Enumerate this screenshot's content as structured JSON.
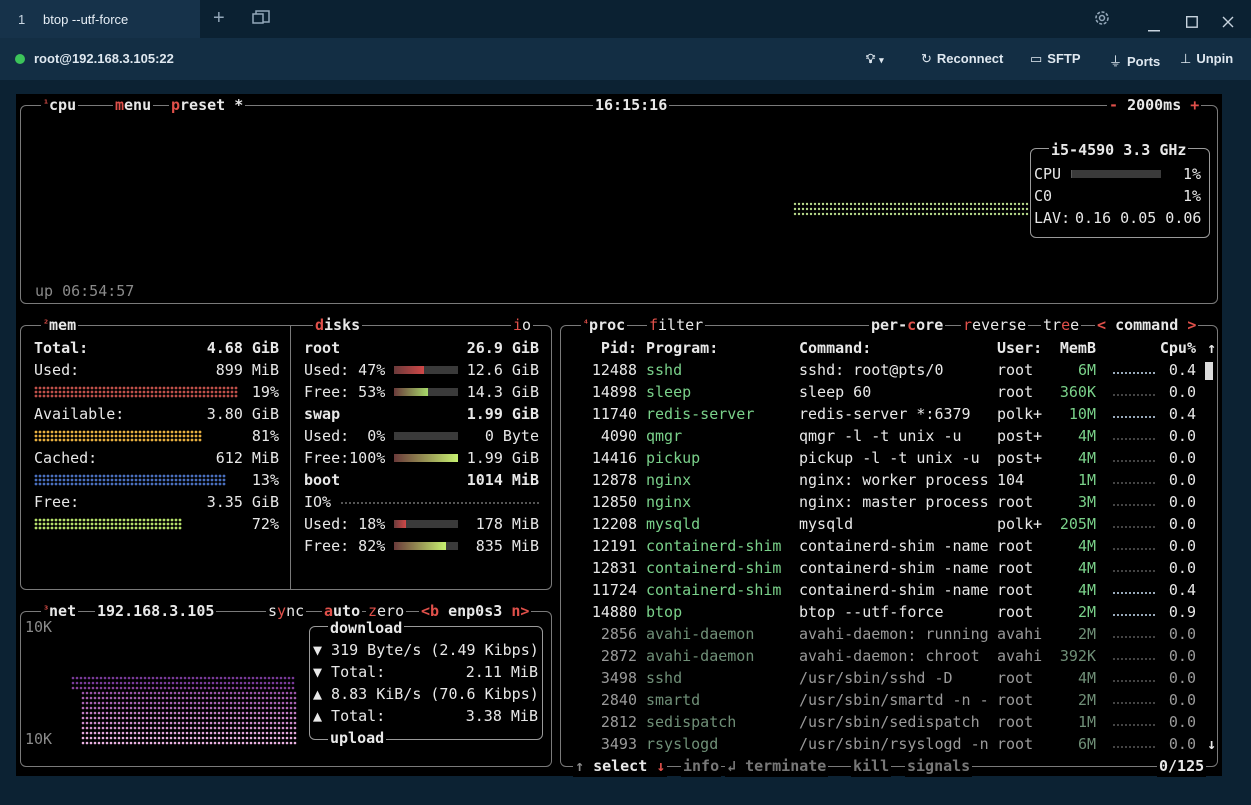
{
  "window": {
    "tab_number": "1",
    "tab_title": "btop --utf-force",
    "new_tab_icon": "plus-icon",
    "tabs_overview_icon": "tabs-icon",
    "settings_icon": "gear-icon",
    "minimize_icon": "minimize-icon",
    "maximize_icon": "maximize-icon",
    "close_icon": "close-icon"
  },
  "connection": {
    "label": "root@192.168.3.105:22",
    "status_color": "#3cc45a",
    "buttons": {
      "hint": "",
      "reconnect": "Reconnect",
      "sftp": "SFTP",
      "ports": "Ports",
      "unpin": "Unpin"
    }
  },
  "cpu": {
    "num": "¹",
    "title": "cpu",
    "menu_key": "m",
    "menu_rest": "enu",
    "preset_key": "p",
    "preset_rest": "reset *",
    "time": "16:15:16",
    "minus": "-",
    "interval": "2000ms",
    "plus": "+",
    "uptime": "up 06:54:57",
    "model": "i5-4590",
    "freq": "3.3 GHz",
    "cpu_label": "CPU",
    "cpu_pct": "1%",
    "core_label": "C0",
    "core_pct": "1%",
    "lav_label": "LAV:",
    "lav": "0.16 0.05 0.06"
  },
  "mem": {
    "num": "²",
    "title": "mem",
    "rows": {
      "total_label": "Total:",
      "total_val": "4.68 GiB",
      "used_label": "Used:",
      "used_val": "899 MiB",
      "used_pct": "19%",
      "avail_label": "Available:",
      "avail_val": "3.80 GiB",
      "avail_pct": "81%",
      "cached_label": "Cached:",
      "cached_val": "612 MiB",
      "cached_pct": "13%",
      "free_label": "Free:",
      "free_val": "3.35 GiB",
      "free_pct": "72%"
    }
  },
  "disks": {
    "title_key": "d",
    "title_rest": "isks",
    "io_key": "i",
    "io_rest": "o",
    "root_label": "root",
    "root_size": "26.9 GiB",
    "root_used": "Used: 47%",
    "root_used_val": "12.6 GiB",
    "root_free": "Free: 53%",
    "root_free_val": "14.3 GiB",
    "swap_label": "swap",
    "swap_size": "1.99 GiB",
    "swap_used": "Used:  0%",
    "swap_used_val": "0 Byte",
    "swap_free": "Free:100%",
    "swap_free_val": "1.99 GiB",
    "boot_label": "boot",
    "boot_size": "1014 MiB",
    "boot_io": "IO%",
    "boot_used": "Used: 18%",
    "boot_used_val": "178 MiB",
    "boot_free": "Free: 82%",
    "boot_free_val": "835 MiB",
    "fills": {
      "root_used": 0.47,
      "root_free": 0.53,
      "swap_used": 0.0,
      "swap_free": 1.0,
      "boot_used": 0.18,
      "boot_free": 0.82
    }
  },
  "net": {
    "num": "³",
    "title": "net",
    "ip": "192.168.3.105",
    "sync_pre": "s",
    "sync_key": "y",
    "sync_rest": "nc",
    "auto_key": "a",
    "auto_rest": "uto",
    "zero_key": "z",
    "zero_rest": "ero",
    "prev_iface": "<b",
    "iface": "enp0s3",
    "next_iface": "n>",
    "scale_top": "10K",
    "scale_bottom": "10K",
    "download": "download",
    "dl_rate": "▼ 319 Byte/s (2.49 Kibps)",
    "dl_total_label": "▼ Total:",
    "dl_total": "2.11 MiB",
    "ul_rate": "▲ 8.83 KiB/s (70.6 Kibps)",
    "ul_total_label": "▲ Total:",
    "ul_total": "3.38 MiB",
    "upload": "upload"
  },
  "proc": {
    "num": "⁴",
    "title": "proc",
    "filter_key": "f",
    "filter_rest": "ilter",
    "percore_pre": "per-",
    "percore_key": "c",
    "percore_rest": "ore",
    "reverse_key": "r",
    "reverse_rest": "everse",
    "tree_pre": "tr",
    "tree_key": "e",
    "tree_rest": "e",
    "sort_left": "<",
    "sort": "command",
    "sort_right": ">",
    "headers": {
      "pid": "Pid:",
      "program": "Program:",
      "command": "Command:",
      "user": "User:",
      "mem": "MemB",
      "cpu": "Cpu%"
    },
    "rows": [
      {
        "pid": "12488",
        "program": "sshd",
        "command": "sshd: root@pts/0",
        "user": "root",
        "mem": "6M",
        "cpu": "0.4"
      },
      {
        "pid": "14898",
        "program": "sleep",
        "command": "sleep 60",
        "user": "root",
        "mem": "360K",
        "cpu": "0.0"
      },
      {
        "pid": "11740",
        "program": "redis-server",
        "command": "redis-server *:6379",
        "user": "polk+",
        "mem": "10M",
        "cpu": "0.4"
      },
      {
        "pid": "4090",
        "program": "qmgr",
        "command": "qmgr -l -t unix -u",
        "user": "post+",
        "mem": "4M",
        "cpu": "0.0"
      },
      {
        "pid": "14416",
        "program": "pickup",
        "command": "pickup -l -t unix -u",
        "user": "post+",
        "mem": "4M",
        "cpu": "0.0"
      },
      {
        "pid": "12878",
        "program": "nginx",
        "command": "nginx: worker process",
        "user": "104",
        "mem": "1M",
        "cpu": "0.0"
      },
      {
        "pid": "12850",
        "program": "nginx",
        "command": "nginx: master process",
        "user": "root",
        "mem": "3M",
        "cpu": "0.0"
      },
      {
        "pid": "12208",
        "program": "mysqld",
        "command": "mysqld",
        "user": "polk+",
        "mem": "205M",
        "cpu": "0.0"
      },
      {
        "pid": "12191",
        "program": "containerd-shim",
        "command": "containerd-shim -name",
        "user": "root",
        "mem": "4M",
        "cpu": "0.0"
      },
      {
        "pid": "12831",
        "program": "containerd-shim",
        "command": "containerd-shim -name",
        "user": "root",
        "mem": "4M",
        "cpu": "0.0"
      },
      {
        "pid": "11724",
        "program": "containerd-shim",
        "command": "containerd-shim -name",
        "user": "root",
        "mem": "4M",
        "cpu": "0.4"
      },
      {
        "pid": "14880",
        "program": "btop",
        "command": "btop --utf-force",
        "user": "root",
        "mem": "2M",
        "cpu": "0.9"
      },
      {
        "pid": "2856",
        "program": "avahi-daemon",
        "command": "avahi-daemon: running",
        "user": "avahi",
        "mem": "2M",
        "cpu": "0.0"
      },
      {
        "pid": "2872",
        "program": "avahi-daemon",
        "command": "avahi-daemon: chroot",
        "user": "avahi",
        "mem": "392K",
        "cpu": "0.0"
      },
      {
        "pid": "3498",
        "program": "sshd",
        "command": "/usr/sbin/sshd -D",
        "user": "root",
        "mem": "4M",
        "cpu": "0.0"
      },
      {
        "pid": "2840",
        "program": "smartd",
        "command": "/usr/sbin/smartd -n -",
        "user": "root",
        "mem": "2M",
        "cpu": "0.0"
      },
      {
        "pid": "2812",
        "program": "sedispatch",
        "command": "/usr/sbin/sedispatch",
        "user": "root",
        "mem": "1M",
        "cpu": "0.0"
      },
      {
        "pid": "3493",
        "program": "rsyslogd",
        "command": "/usr/sbin/rsyslogd -n",
        "user": "root",
        "mem": "6M",
        "cpu": "0.0"
      }
    ],
    "footer": {
      "up": "↑",
      "select": "select",
      "down": "↓",
      "info": "info",
      "enter": "↲",
      "terminate": "terminate",
      "kill": "kill",
      "signals": "signals",
      "count": "0/125"
    },
    "scroll_up": "↑",
    "scroll_down": "↓"
  }
}
